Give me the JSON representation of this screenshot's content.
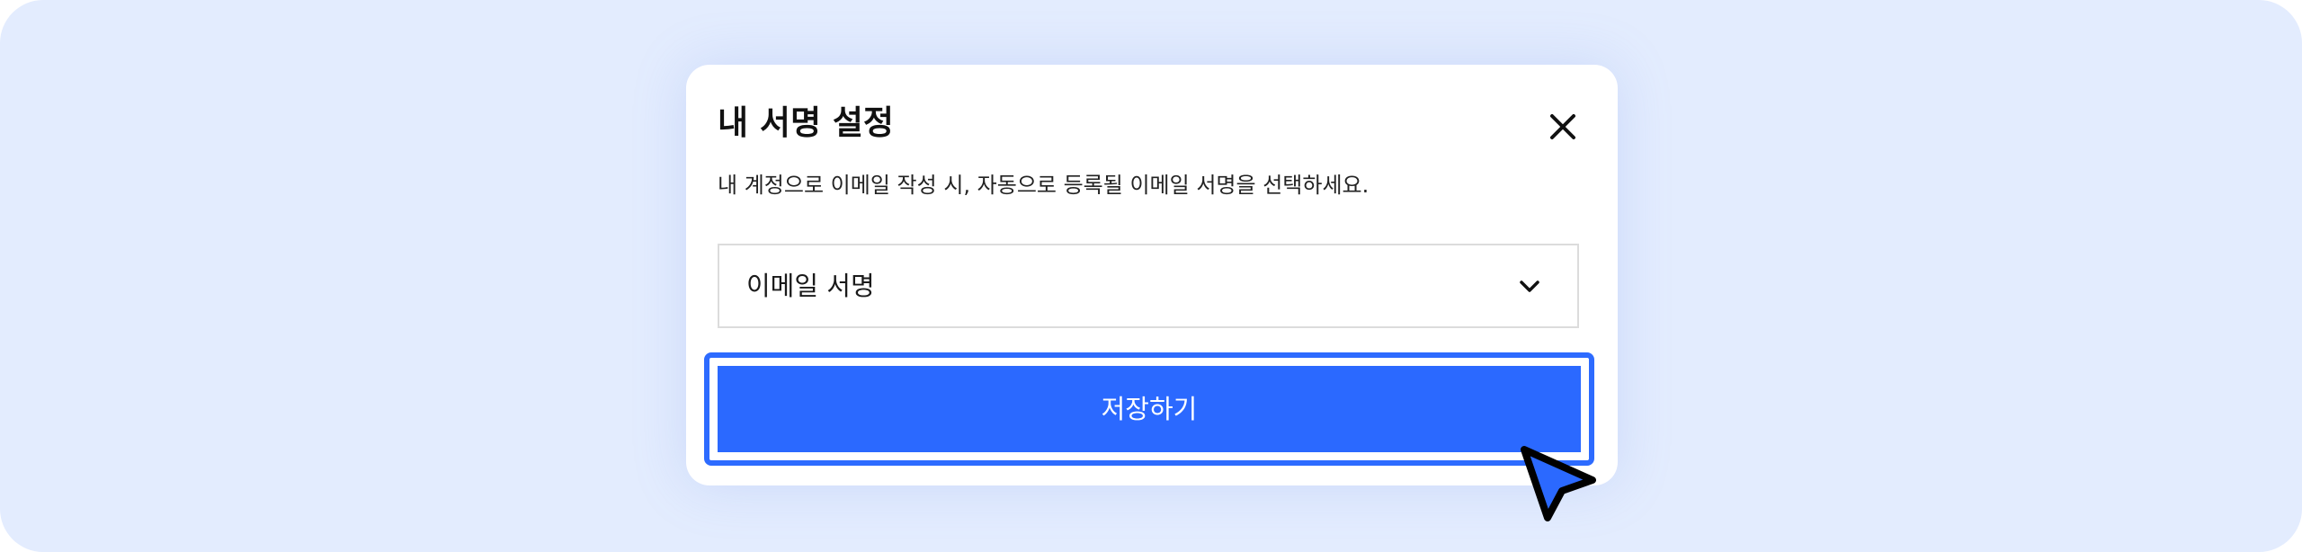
{
  "dialog": {
    "title": "내 서명 설정",
    "description": "내 계정으로 이메일 작성 시, 자동으로 등록될 이메일 서명을 선택하세요.",
    "close_icon": "close-icon"
  },
  "signature_select": {
    "selected": "이메일 서명",
    "icon": "chevron-down-icon"
  },
  "save_button": {
    "label": "저장하기"
  },
  "colors": {
    "background": "#e3ecfe",
    "accent": "#2b69ff",
    "focus_ring": "#2d6bff",
    "cursor_fill": "#2b69ff"
  }
}
